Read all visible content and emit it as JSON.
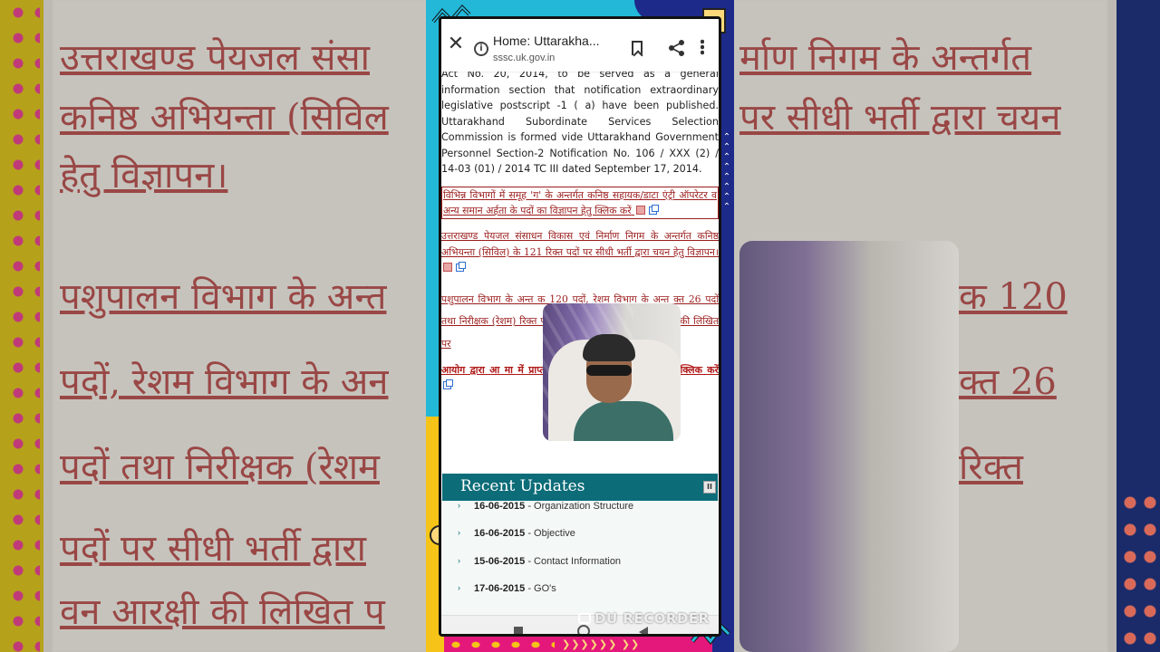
{
  "background": {
    "lines": [
      "उत्तराखण्ड पेयजल संसा",
      "कनिष्ठ अभियन्ता (सिविल",
      "हेतु विज्ञापन।",
      "पशुपालन विभाग के अन्त",
      "पदों, रेशम विभाग के अन",
      "पदों तथा निरीक्षक (रेशम",
      "पदों पर सीधी भर्ती द्वारा",
      "वन आरक्षी की लिखित प"
    ],
    "right_lines": [
      "र्माण निगम के अन्तर्गत",
      "पर सीधी भर्ती द्वारा चयन",
      "क 120",
      "क्त 26",
      "रिक्त"
    ]
  },
  "browser": {
    "title": "Home: Uttarakha...",
    "domain": "sssc.uk.gov.in",
    "icons": [
      "close-icon",
      "info-icon",
      "bookmark-icon",
      "share-icon",
      "more-icon"
    ]
  },
  "content": {
    "intro": "Act No. 20, 2014, to be served as a general information section that notification extraordinary legislative postscript -1 ( a) have been published. Uttarakhand Subordinate Services Selection Commission is formed vide Uttarakhand Government Personnel Section-2 Notification No. 106 / XXX (2) / 14-03 (01) / 2014 TC III dated September 17, 2014.",
    "notice1": "विभिन्न विभागों में समूह 'ग' के अन्तर्गत कनिष्ठ सहायक/डाटा एंट्री ऑपरेटर व अन्य समान अर्हता के पदों का विज्ञापन हेतु क्लिक करें",
    "notice2": "उत्तराखण्ड पेयजल संसाधन विकास एवं निर्माण निगम के अन्तर्गत कनिष्ठ अभियन्ता (सिविल) के 121 रिक्त पदों पर सीधी भर्ती द्वारा चयन हेतु विज्ञापन।",
    "notice3": "पशुपालन विभाग के अन्त                                                  क 120 पदों, रेशम विभाग के अन्त                                           क्त 26 पदों तथा निरीक्षक (रेशम)                                                रिक्त पदों पर सीधी भर्ती द्वारा च वन आरक्षी की लिखित पर",
    "notice4": "आयोग द्वारा आ                                                     मा में प्राप्तांक,ओ०एम०आर०की स्कैन प्रति हेतु क्लिक करें"
  },
  "recent": {
    "heading": "Recent Updates",
    "pause_label": "II",
    "items": [
      {
        "date": "16-06-2015",
        "text": " - Organization Structure"
      },
      {
        "date": "16-06-2015",
        "text": " - Objective"
      },
      {
        "date": "15-06-2015",
        "text": " - Contact Information"
      },
      {
        "date": "17-06-2015",
        "text": " - GO's"
      }
    ]
  },
  "watermark": "DU RECORDER",
  "colors": {
    "accent_teal": "#0c6c78",
    "notice_red": "#9b1c1c",
    "frame_pink": "#e4187a",
    "frame_cyan": "#23b7d8",
    "frame_blue": "#1d2a8a",
    "frame_yellow": "#f6c418"
  }
}
